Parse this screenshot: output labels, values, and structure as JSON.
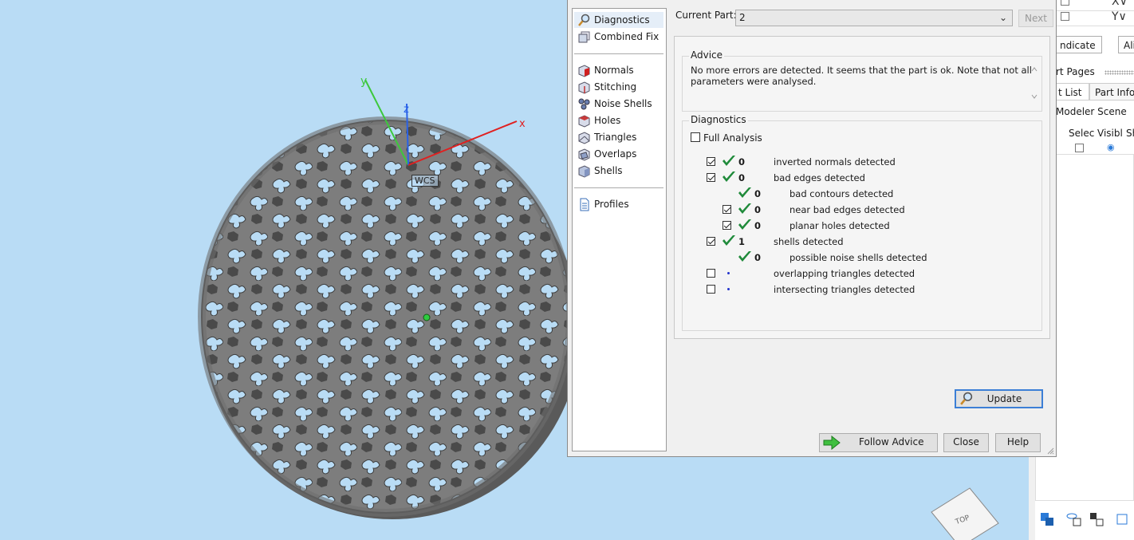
{
  "viewport": {
    "wcs_label": "WCS",
    "axis_labels": {
      "x": "x",
      "y": "y",
      "z": "z"
    },
    "view_cube_label": "TOP"
  },
  "dialog": {
    "nav": {
      "top_items": [
        {
          "label": "Diagnostics",
          "icon": "magnifier-icon",
          "selected": true
        },
        {
          "label": "Combined Fix",
          "icon": "combined-fix-icon",
          "selected": false
        }
      ],
      "mid_items": [
        {
          "label": "Normals",
          "icon": "normals-cube-icon"
        },
        {
          "label": "Stitching",
          "icon": "stitching-cube-icon"
        },
        {
          "label": "Noise Shells",
          "icon": "noise-shells-icon"
        },
        {
          "label": "Holes",
          "icon": "holes-cube-icon"
        },
        {
          "label": "Triangles",
          "icon": "triangles-cube-icon"
        },
        {
          "label": "Overlaps",
          "icon": "overlaps-cube-icon"
        },
        {
          "label": "Shells",
          "icon": "shells-cube-icon"
        }
      ],
      "bottom_items": [
        {
          "label": "Profiles",
          "icon": "document-icon"
        }
      ]
    },
    "current_part_label": "Current Part:",
    "current_part_value": "2",
    "next_label": "Next",
    "advice": {
      "title": "Advice",
      "text": "No more errors are detected. It seems that the part is ok. Note that not all parameters were analysed."
    },
    "diagnostics": {
      "title": "Diagnostics",
      "full_analysis_label": "Full Analysis",
      "full_analysis_checked": false,
      "rows": [
        {
          "checkbox": true,
          "checked": true,
          "status": "ok",
          "count": "0",
          "label": "inverted normals detected",
          "indent": 0
        },
        {
          "checkbox": true,
          "checked": true,
          "status": "ok",
          "count": "0",
          "label": "bad edges detected",
          "indent": 0
        },
        {
          "checkbox": false,
          "checked": false,
          "status": "ok",
          "count": "0",
          "label": "bad contours detected",
          "indent": 1
        },
        {
          "checkbox": true,
          "checked": true,
          "status": "ok",
          "count": "0",
          "label": "near bad edges detected",
          "indent": 1
        },
        {
          "checkbox": true,
          "checked": true,
          "status": "ok",
          "count": "0",
          "label": "planar holes detected",
          "indent": 1
        },
        {
          "checkbox": true,
          "checked": true,
          "status": "ok",
          "count": "1",
          "label": "shells detected",
          "indent": 0
        },
        {
          "checkbox": false,
          "checked": false,
          "status": "ok",
          "count": "0",
          "label": "possible noise shells detected",
          "indent": 1
        },
        {
          "checkbox": true,
          "checked": false,
          "status": "pending",
          "count": "",
          "label": "overlapping triangles detected",
          "indent": 0
        },
        {
          "checkbox": true,
          "checked": false,
          "status": "pending",
          "count": "",
          "label": "intersecting triangles detected",
          "indent": 0
        }
      ],
      "update_label": "Update"
    },
    "footer": {
      "follow_advice_label": "Follow Advice",
      "close_label": "Close",
      "help_label": "Help"
    }
  },
  "right_panel": {
    "top_rows": [
      {
        "label": "X∨"
      },
      {
        "label": "Y∨"
      }
    ],
    "indicate_label": "ndicate",
    "ali_label": "Ali",
    "part_pages_label": "rt Pages",
    "tabs": [
      {
        "label": "t List"
      },
      {
        "label": "Part Info"
      }
    ],
    "scene_label": "Modeler Scene",
    "columns": [
      "Selec",
      "Visibl",
      "Sh"
    ]
  },
  "colors": {
    "viewport_bg": "#b9dcf5",
    "mesh_fill": "#7d7d7d",
    "check_green": "#1f8a3a",
    "accent_blue": "#3c7fd6"
  }
}
